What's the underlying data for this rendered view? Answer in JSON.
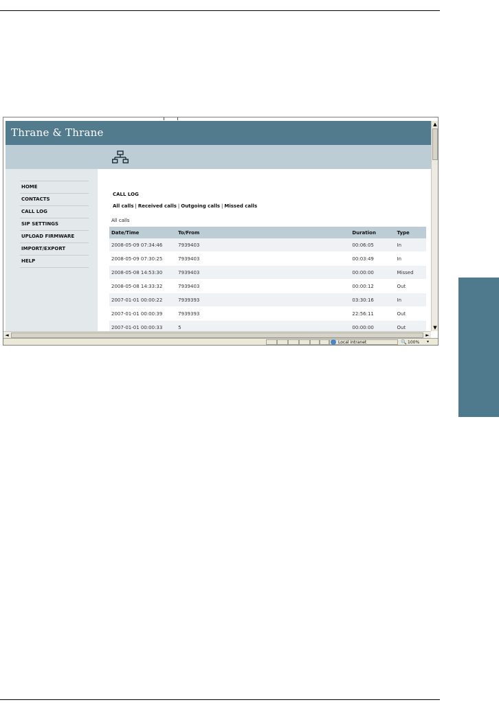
{
  "browser": {
    "zone_label": "Local intranet",
    "zoom_label": "100%",
    "scroll_up": "▲",
    "scroll_down": "▼",
    "scroll_left": "◄",
    "scroll_right": "►",
    "zoom_arrow": "▾"
  },
  "header": {
    "brand": "Thrane & Thrane",
    "brand_color": "#527b8d",
    "subbar_color": "#bccdd5",
    "icon": "network-icon"
  },
  "nav": {
    "items": [
      "HOME",
      "CONTACTS",
      "CALL LOG",
      "SIP SETTINGS",
      "UPLOAD FIRMWARE",
      "IMPORT/EXPORT",
      "HELP"
    ]
  },
  "main": {
    "title": "CALL LOG",
    "filters": [
      "All calls",
      "Received calls",
      "Outgoing calls",
      "Missed calls"
    ],
    "section_label": "All calls",
    "table": {
      "headers": [
        "Date/Time",
        "To/From",
        "Duration",
        "Type"
      ],
      "rows": [
        [
          "2008-05-09 07:34:46",
          "7939403",
          "00:06:05",
          "In"
        ],
        [
          "2008-05-09 07:30:25",
          "7939403",
          "00:03:49",
          "In"
        ],
        [
          "2008-05-08 14:53:30",
          "7939403",
          "00:00:00",
          "Missed"
        ],
        [
          "2008-05-08 14:33:32",
          "7939403",
          "00:00:12",
          "Out"
        ],
        [
          "2007-01-01 00:00:22",
          "7939393",
          "03:30:16",
          "In"
        ],
        [
          "2007-01-01 00:00:39",
          "7939393",
          "22:56:11",
          "Out"
        ],
        [
          "2007-01-01 00:00:33",
          "5",
          "00:00:00",
          "Out"
        ]
      ]
    }
  },
  "page": {
    "side_tab_color": "#4f7a8e"
  }
}
